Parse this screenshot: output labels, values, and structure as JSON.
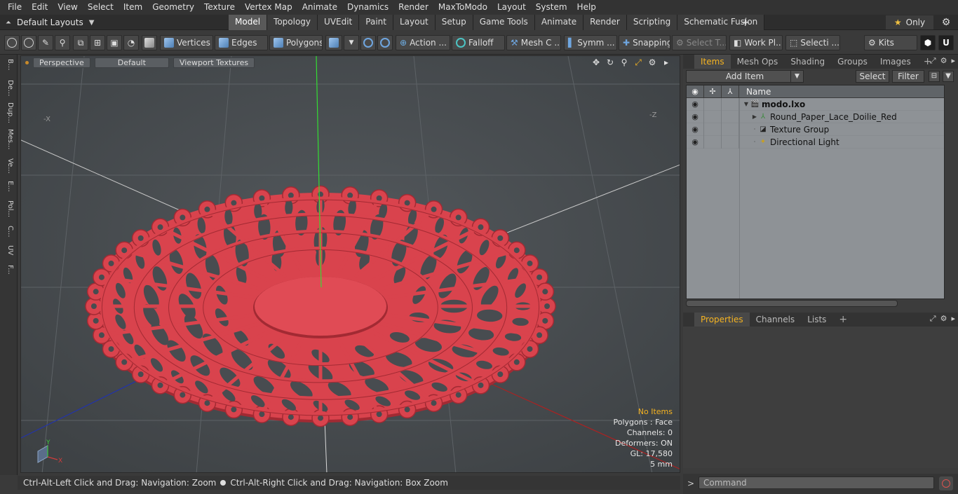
{
  "menu": [
    "File",
    "Edit",
    "View",
    "Select",
    "Item",
    "Geometry",
    "Texture",
    "Vertex Map",
    "Animate",
    "Dynamics",
    "Render",
    "MaxToModo",
    "Layout",
    "System",
    "Help"
  ],
  "layouts": {
    "label": "Default Layouts"
  },
  "tabs": [
    {
      "label": "Model",
      "active": true
    },
    {
      "label": "Topology"
    },
    {
      "label": "UVEdit"
    },
    {
      "label": "Paint"
    },
    {
      "label": "Layout"
    },
    {
      "label": "Setup"
    },
    {
      "label": "Game Tools"
    },
    {
      "label": "Animate"
    },
    {
      "label": "Render"
    },
    {
      "label": "Scripting"
    },
    {
      "label": "Schematic Fusion"
    }
  ],
  "only_label": "Only",
  "toolbar": {
    "vertices": "Vertices",
    "edges": "Edges",
    "polygons": "Polygons",
    "action": "Action ...",
    "falloff": "Falloff",
    "mesh": "Mesh C ...",
    "symm": "Symm ...",
    "snapping": "Snapping",
    "select_t": "Select T...",
    "work_plane": "Work Pl...",
    "selecti": "Selecti ...",
    "kits": "Kits"
  },
  "left_tabs": [
    "B...",
    "De...",
    "Dup...",
    "Mes...",
    "Ve...",
    "E...",
    "Pol...",
    "C...",
    "UV",
    "F..."
  ],
  "viewport": {
    "view": "Perspective",
    "shading": "Default",
    "textures": "Viewport Textures",
    "stats": {
      "selection": "No Items",
      "polygons": "Polygons : Face",
      "channels": "Channels: 0",
      "deformers": "Deformers: ON",
      "gl": "GL: 17,580",
      "unit": "5 mm"
    },
    "axis_x": "X",
    "axis_y": "Y",
    "corner_left": "-X",
    "corner_right": "-Z"
  },
  "status": {
    "left": "Ctrl-Alt-Left Click and Drag: Navigation: Zoom",
    "right": "Ctrl-Alt-Right Click and Drag: Navigation: Box Zoom"
  },
  "items_panel": {
    "tabs": [
      "Items",
      "Mesh Ops",
      "Shading",
      "Groups",
      "Images"
    ],
    "add_item": "Add Item",
    "select": "Select",
    "filter": "Filter",
    "name_header": "Name",
    "rows": [
      {
        "name": "modo.lxo",
        "bold": true,
        "level": 0
      },
      {
        "name": "Round_Paper_Lace_Doilie_Red",
        "level": 1
      },
      {
        "name": "Texture Group",
        "level": 1
      },
      {
        "name": "Directional Light",
        "level": 1
      }
    ]
  },
  "props_panel": {
    "tabs": [
      "Properties",
      "Channels",
      "Lists"
    ]
  },
  "command": {
    "prompt": ">",
    "placeholder": "Command"
  },
  "colors": {
    "doily": "#d9434d",
    "doily_dark": "#a22a33",
    "accent": "#f5b321"
  }
}
